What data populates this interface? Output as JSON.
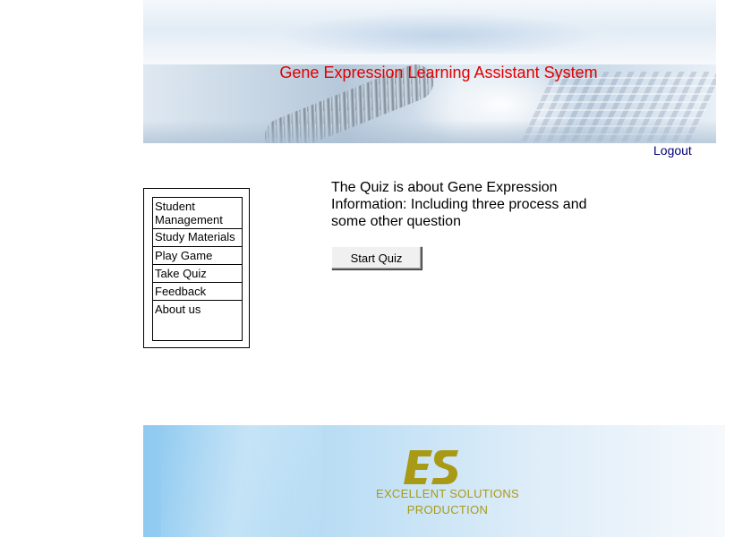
{
  "header": {
    "title": "Gene Expression Learning Assistant System",
    "logout_label": "Logout"
  },
  "menu": {
    "items": [
      {
        "label": "Student Management"
      },
      {
        "label": "Study Materials"
      },
      {
        "label": "Play Game"
      },
      {
        "label": "Take Quiz"
      },
      {
        "label": "Feedback"
      },
      {
        "label": "About us"
      }
    ]
  },
  "main": {
    "description": "The Quiz is about Gene Expression Information: Including three process and some other question",
    "start_button_label": "Start Quiz"
  },
  "footer": {
    "logo_letters": "ES",
    "company_line1": "EXCELLENT SOLUTIONS",
    "company_line2": "PRODUCTION"
  },
  "colors": {
    "title": "#e00000",
    "logout_link": "#00007a",
    "logo_gold": "#a89a16",
    "footer_blue": "#8fcaf0"
  }
}
